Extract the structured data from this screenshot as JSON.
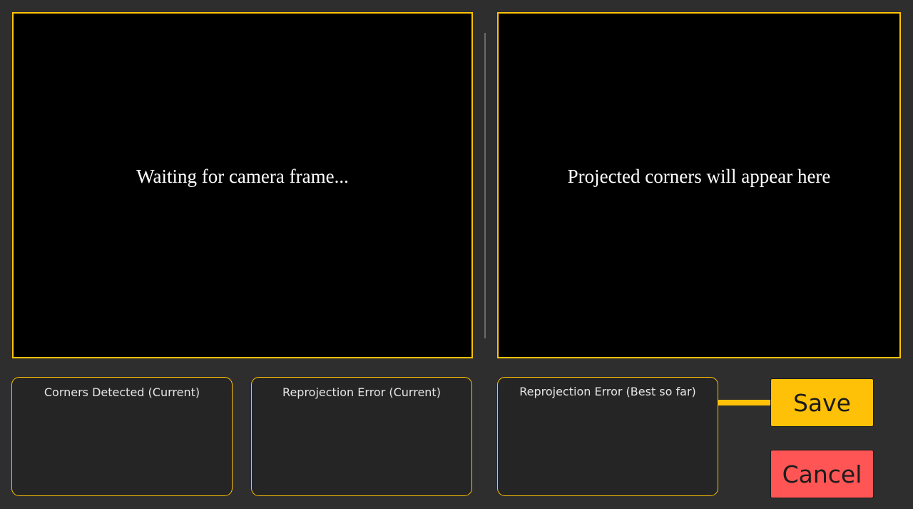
{
  "camera_view": {
    "placeholder": "Waiting for camera frame..."
  },
  "projection_view": {
    "placeholder": "Projected corners will appear here"
  },
  "stats": {
    "corners_detected_current": {
      "label": "Corners Detected (Current)"
    },
    "reprojection_error_current": {
      "label": "Reprojection Error (Current)"
    },
    "reprojection_error_best": {
      "label": "Reprojection Error (Best so far)"
    }
  },
  "actions": {
    "save_label": "Save",
    "cancel_label": "Cancel"
  },
  "colors": {
    "accent": "#ffc107",
    "cancel": "#ff5555",
    "background": "#2e2e2e",
    "panel": "#252525"
  }
}
